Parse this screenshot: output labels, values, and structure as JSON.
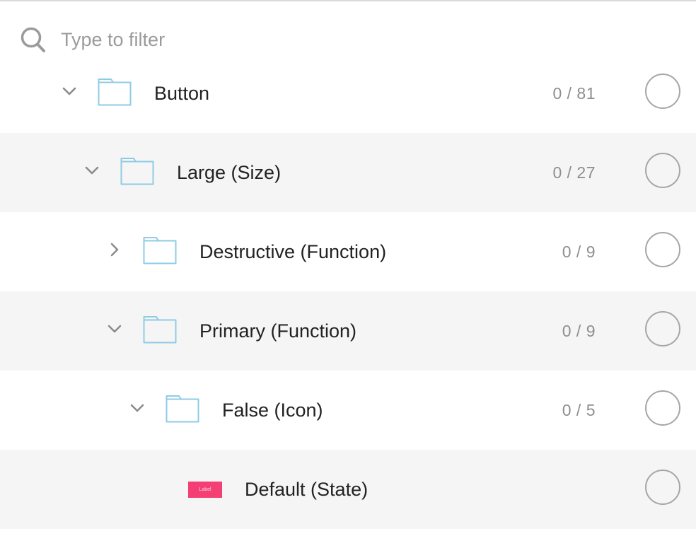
{
  "search": {
    "placeholder": "Type to filter",
    "value": ""
  },
  "tree": [
    {
      "label": "Button",
      "count": "0 / 81",
      "expanded": true,
      "kind": "folder",
      "depth": 0
    },
    {
      "label": "Large (Size)",
      "count": "0 / 27",
      "expanded": true,
      "kind": "folder",
      "depth": 1
    },
    {
      "label": "Destructive (Function)",
      "count": "0 / 9",
      "expanded": false,
      "kind": "folder",
      "depth": 2
    },
    {
      "label": "Primary (Function)",
      "count": "0 / 9",
      "expanded": true,
      "kind": "folder",
      "depth": 2
    },
    {
      "label": "False (Icon)",
      "count": "0 / 5",
      "expanded": true,
      "kind": "folder",
      "depth": 3
    },
    {
      "label": "Default (State)",
      "count": "",
      "kind": "component",
      "depth": 4,
      "thumbnail_text": "Label",
      "thumbnail_color": "#f43f75"
    }
  ],
  "colors": {
    "folder_outline": "#8fcbe4",
    "shaded_row": "#f5f5f5",
    "count_text": "#8e8e8e",
    "circle_outline": "#a6a6a6"
  },
  "icons": {
    "search": "search-icon",
    "expanded": "chevron-down-icon",
    "collapsed": "chevron-right-icon",
    "folder": "folder-icon",
    "select": "radio-circle"
  }
}
